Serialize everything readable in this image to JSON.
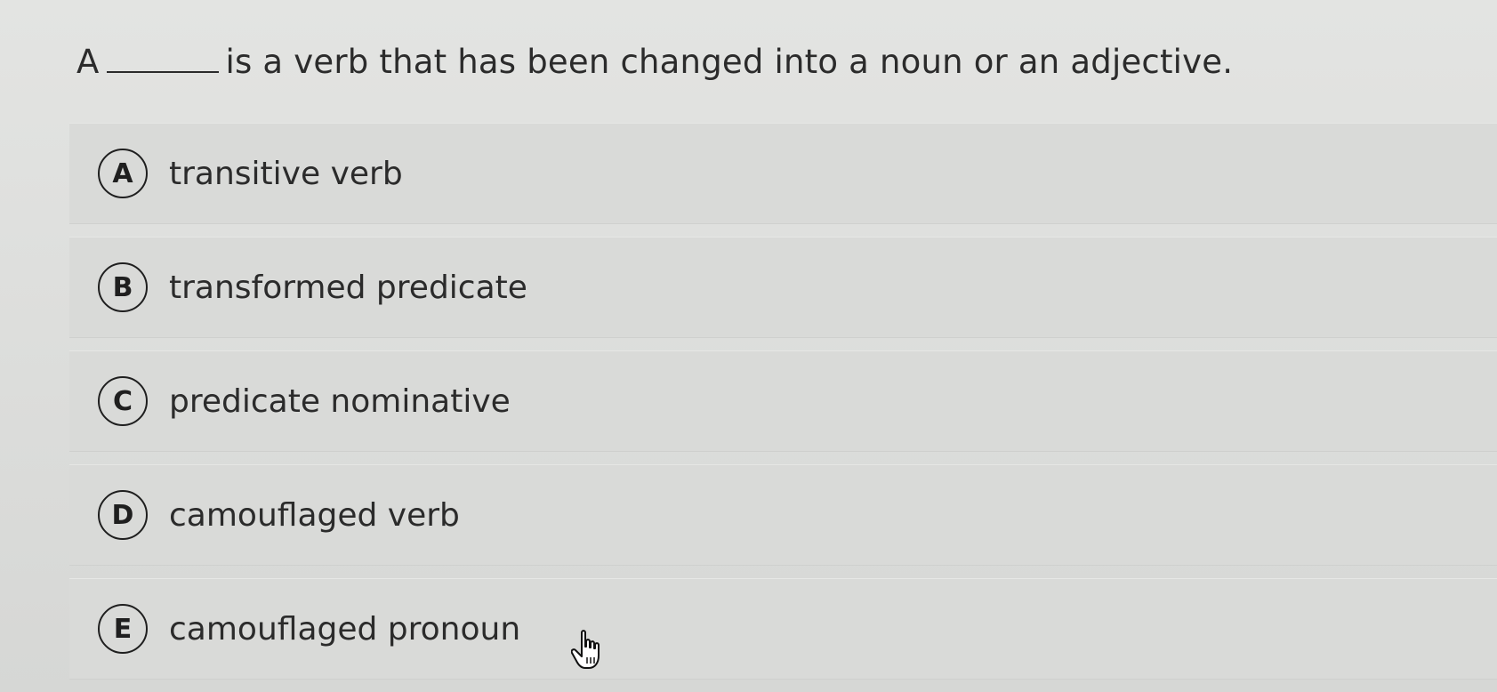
{
  "question": {
    "prefix": "A",
    "suffix": "is a verb that has been changed into a noun or an adjective."
  },
  "options": [
    {
      "letter": "A",
      "text": "transitive verb"
    },
    {
      "letter": "B",
      "text": "transformed predicate"
    },
    {
      "letter": "C",
      "text": "predicate nominative"
    },
    {
      "letter": "D",
      "text": "camouflaged verb"
    },
    {
      "letter": "E",
      "text": "camouflaged pronoun"
    }
  ],
  "cursor": {
    "icon": "hand-pointer-icon"
  },
  "colors": {
    "text": "#2b2b2b",
    "background": "#dcdddb",
    "option_bg": "#d9dad8"
  }
}
